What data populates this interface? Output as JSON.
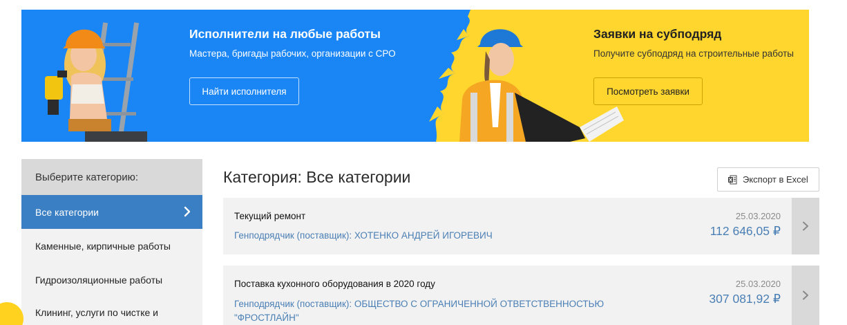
{
  "banner": {
    "left": {
      "title": "Исполнители на любые работы",
      "subtitle": "Мастера, бригады рабочих, организации с СРО",
      "button": "Найти исполнителя"
    },
    "right": {
      "title": "Заявки на субподряд",
      "subtitle": "Получите субподряд на строительные работы",
      "button": "Посмотреть заявки"
    },
    "colors": {
      "blue": "#1a86f5",
      "yellow": "#ffd62e"
    }
  },
  "sidebar": {
    "header": "Выберите категорию:",
    "items": [
      {
        "label": "Все категории",
        "active": true
      },
      {
        "label": "Каменные, кирпичные работы",
        "active": false
      },
      {
        "label": "Гидроизоляционные работы",
        "active": false
      },
      {
        "label": "Клининг, услуги по чистке и",
        "active": false
      }
    ]
  },
  "main": {
    "title": "Категория: Все категории",
    "export_label": "Экспорт в Excel",
    "cards": [
      {
        "title": "Текущий ремонт",
        "supplier": "Генподрядчик (поставщик): ХОТЕНКО АНДРЕЙ ИГОРЕВИЧ",
        "date": "25.03.2020",
        "price": "112 646,05 ₽"
      },
      {
        "title": "Поставка кухонного оборудования в 2020 году",
        "supplier_line1": "Генподрядчик (поставщик): ОБЩЕСТВО С ОГРАНИЧЕННОЙ ОТВЕТСТВЕННОСТЬЮ",
        "supplier_line2": "\"ФРОСТЛАЙН\"",
        "date": "25.03.2020",
        "price": "307 081,92 ₽"
      }
    ]
  },
  "icons": {
    "chevron_right": "chevron-right-icon",
    "excel": "excel-icon",
    "chat": "chat-icon"
  }
}
